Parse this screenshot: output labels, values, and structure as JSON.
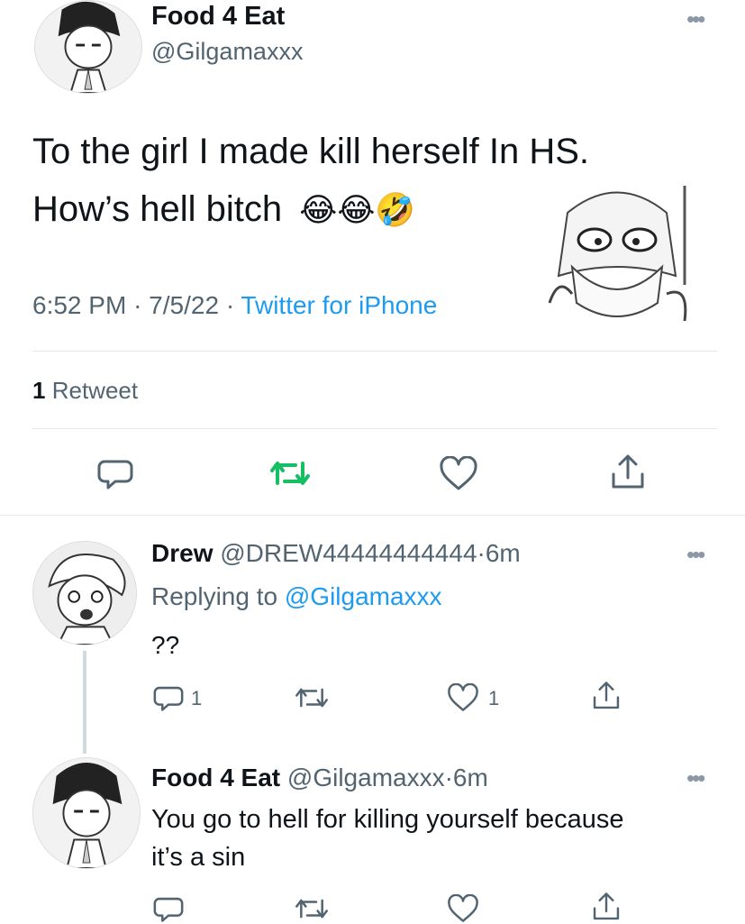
{
  "main_tweet": {
    "author_name": "Food 4 Eat",
    "author_handle": "@Gilgamaxxx",
    "text_line1": "To the girl I made kill herself In HS.",
    "text_line2": "How’s hell bitch",
    "emojis": "😂😂🤣",
    "time": "6:52 PM",
    "sep1": "·",
    "date": "7/5/22",
    "sep2": "·",
    "client": "Twitter for iPhone",
    "retweet_count": "1",
    "retweet_label": "Retweet"
  },
  "reply1": {
    "author_name": "Drew",
    "author_handle": "@DREW44444444444",
    "sep": "·",
    "time_ago": "6m",
    "replying_prefix": "Replying to",
    "replying_handle": "@Gilgamaxxx",
    "text": "??",
    "reply_count": "1",
    "like_count": "1"
  },
  "reply2": {
    "author_name": "Food 4 Eat",
    "author_handle": "@Gilgamaxxx",
    "sep": "·",
    "time_ago": "6m",
    "text_line1": "You go to hell for killing yourself because",
    "text_line2": "it’s a sin"
  },
  "icons": {
    "more": "more-dots-icon",
    "reply": "reply-icon",
    "retweet": "retweet-icon",
    "like": "heart-icon",
    "share": "share-icon"
  },
  "colors": {
    "retweet_active": "#17bf63",
    "link": "#1d9bf0",
    "gray": "#536471"
  }
}
